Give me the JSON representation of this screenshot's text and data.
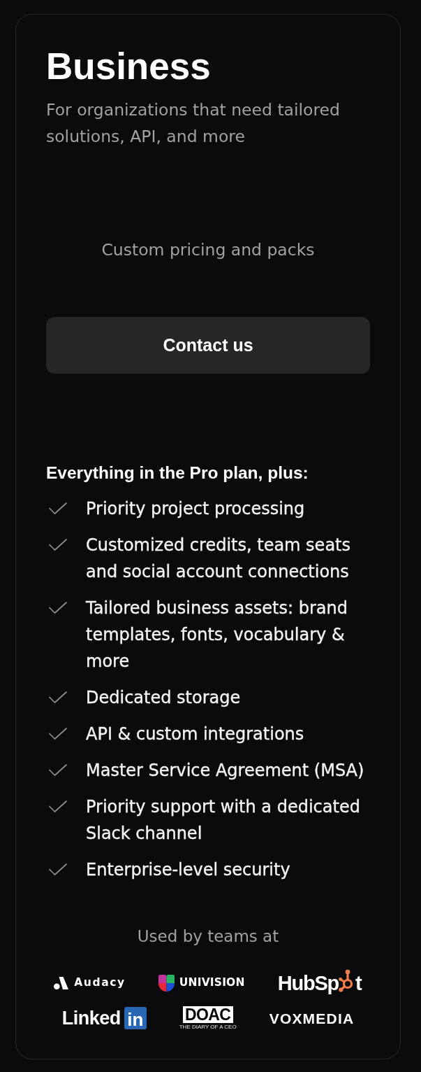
{
  "plan": {
    "title": "Business",
    "description": "For organizations that need tailored solutions, API, and more",
    "pricing": "Custom pricing and packs",
    "cta": "Contact us"
  },
  "features": {
    "heading": "Everything in the Pro plan, plus:",
    "items": [
      "Priority project processing",
      "Customized credits, team seats and social account connections",
      "Tailored business assets: brand templates, fonts, vocabulary & more",
      "Dedicated storage",
      "API & custom integrations",
      "Master Service Agreement (MSA)",
      "Priority support with a dedicated Slack channel",
      "Enterprise-level security"
    ]
  },
  "customers": {
    "heading": "Used by teams at",
    "logos": [
      {
        "kind": "audacy",
        "text": "Audacy"
      },
      {
        "kind": "univision",
        "text": "UNIVISION"
      },
      {
        "kind": "hubspot",
        "text": "HubSp",
        "text_after": "t"
      },
      {
        "kind": "linkedin",
        "text": "Linked",
        "tile": "in"
      },
      {
        "kind": "doac",
        "text": "DOAC",
        "tagline": "THE DIARY OF A CEO"
      },
      {
        "kind": "voxmedia",
        "text": "VOXMEDIA"
      }
    ]
  }
}
